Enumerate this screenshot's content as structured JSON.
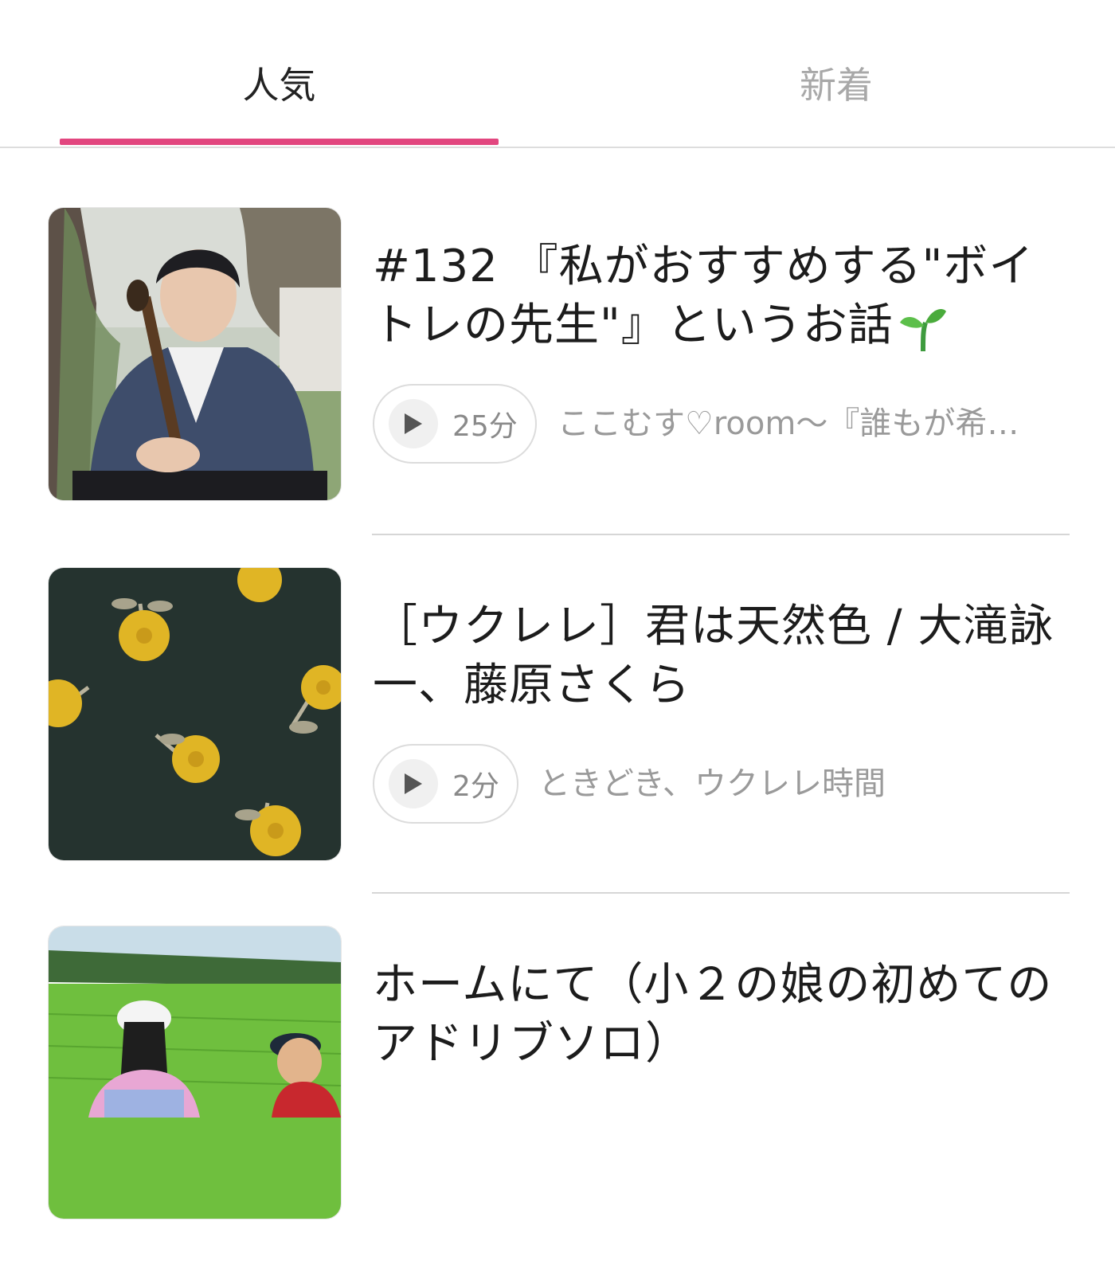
{
  "tabs": {
    "popular_label": "人気",
    "new_label": "新着",
    "active": "popular",
    "accent_color": "#e2467f"
  },
  "episodes": [
    {
      "title": "#132 『私がおすすめする\"ボイトレの先生\"』というお話",
      "title_emoji": "seedling-icon",
      "duration": "25分",
      "channel": "ここむす♡room〜『誰もが希…",
      "thumbnail": "man-with-guitar-photo"
    },
    {
      "title": "［ウクレレ］君は天然色 / 大滝詠一、藤原さくら",
      "duration": "2分",
      "channel": "ときどき、ウクレレ時間",
      "thumbnail": "embroidered-yellow-flowers-photo"
    },
    {
      "title": "ホームにて（小２の娘の初めてのアドリブソロ）",
      "duration": "",
      "channel": "",
      "thumbnail": "children-rice-field-photo"
    }
  ]
}
